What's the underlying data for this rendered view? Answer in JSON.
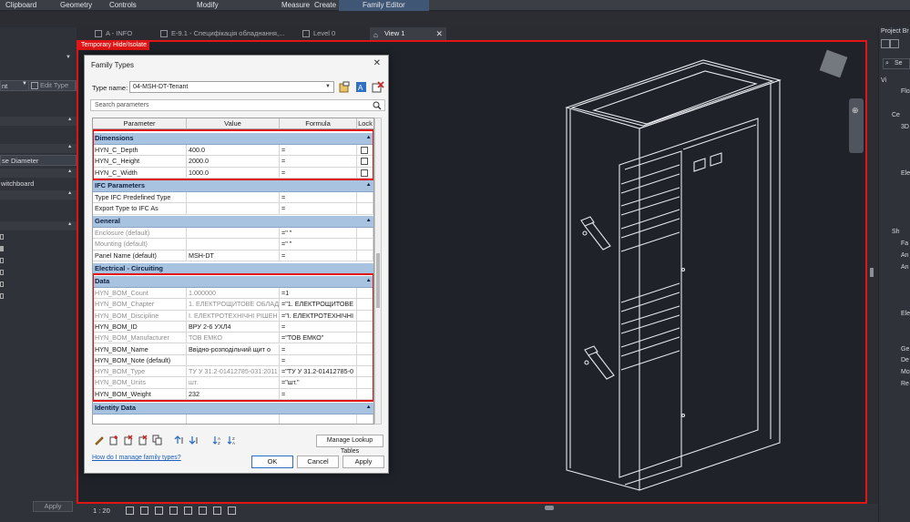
{
  "ribbon": {
    "tabs": [
      "Clipboard",
      "Geometry",
      "Controls",
      "Modify",
      "Measure",
      "Create",
      "Family Editor"
    ]
  },
  "left_panel": {
    "type_selector_value": "nt",
    "edit_type_label": "Edit Type",
    "param_label_1": "se Diameter",
    "param_label_2": "witchboard",
    "apply_label": "Apply"
  },
  "view_tabs": [
    {
      "label": "A - INFO"
    },
    {
      "label": "E-9.1 - Специфікація обладнання,..."
    },
    {
      "label": "Level 0"
    },
    {
      "label": "View 1"
    }
  ],
  "canvas": {
    "temp_hide_label": "Temporary Hide/Isolate",
    "scale_label": "1 : 20"
  },
  "project_browser": {
    "title": "Project Br",
    "search_placeholder": "Se",
    "items": [
      "Vi",
      "Flo",
      "Ce",
      "3D",
      "Ele",
      "Sh",
      "Fa",
      "An",
      "An",
      "Ele",
      "Ge",
      "De",
      "Mo",
      "Re"
    ]
  },
  "dialog": {
    "title": "Family Types",
    "close_label": "✕",
    "type_name_label": "Type name:",
    "type_name_value": "04-MSH-DT-Tenant",
    "search_placeholder": "Search parameters",
    "columns": [
      "Parameter",
      "Value",
      "Formula",
      "Lock"
    ],
    "groups": {
      "dimensions": {
        "name": "Dimensions",
        "rows": [
          {
            "parameter": "HYN_C_Depth",
            "value": "400.0",
            "formula": "="
          },
          {
            "parameter": "HYN_C_Height",
            "value": "2000.0",
            "formula": "="
          },
          {
            "parameter": "HYN_C_Width",
            "value": "1000.0",
            "formula": "="
          }
        ]
      },
      "ifc": {
        "name": "IFC Parameters",
        "rows": [
          {
            "parameter": "Type IFC Predefined Type",
            "value": "",
            "formula": "="
          },
          {
            "parameter": "Export Type to IFC As",
            "value": "",
            "formula": "="
          }
        ]
      },
      "general": {
        "name": "General",
        "rows": [
          {
            "parameter": "Enclosure (default)",
            "value": "",
            "formula": "=\" \""
          },
          {
            "parameter": "Mounting (default)",
            "value": "",
            "formula": "=\" \""
          },
          {
            "parameter": "Panel Name (default)",
            "value": "MSH-DT",
            "formula": "="
          }
        ]
      },
      "electrical": {
        "name": "Electrical - Circuiting"
      },
      "data": {
        "name": "Data",
        "rows": [
          {
            "parameter": "HYN_BOM_Count",
            "value": "1.000000",
            "formula": "=1"
          },
          {
            "parameter": "HYN_BOM_Chapter",
            "value": "1. ЕЛЕКТРОЩИТОВЕ ОБЛАД",
            "formula": "=\"1. ЕЛЕКТРОЩИТОВЕ"
          },
          {
            "parameter": "HYN_BOM_Discipline",
            "value": "І. ЕЛЕКТРОТЕХНІЧНІ РІШЕН",
            "formula": "=\"І. ЕЛЕКТРОТЕХНІЧНІ"
          },
          {
            "parameter": "HYN_BOM_ID",
            "value": "ВРУ 2-6 УХЛ4",
            "formula": "="
          },
          {
            "parameter": "HYN_BOM_Manufacturer",
            "value": "ТОВ ЕМКО",
            "formula": "=\"ТОВ ЕМКО\""
          },
          {
            "parameter": "HYN_BOM_Name",
            "value": "Ввідно-розподільчий щит о",
            "formula": "="
          },
          {
            "parameter": "HYN_BOM_Note (default)",
            "value": "",
            "formula": "="
          },
          {
            "parameter": "HYN_BOM_Type",
            "value": "ТУ У 31.2-01412785-031:2011",
            "formula": "=\"ТУ У 31.2-01412785-0"
          },
          {
            "parameter": "HYN_BOM_Units",
            "value": "шт.",
            "formula": "=\"шт.\""
          },
          {
            "parameter": "HYN_BOM_Weight",
            "value": "232",
            "formula": "="
          }
        ]
      },
      "identity": {
        "name": "Identity Data"
      }
    },
    "manage_lookup_label": "Manage Lookup Tables",
    "help_link": "How do I manage family types?",
    "ok_label": "OK",
    "cancel_label": "Cancel",
    "apply_label": "Apply"
  }
}
